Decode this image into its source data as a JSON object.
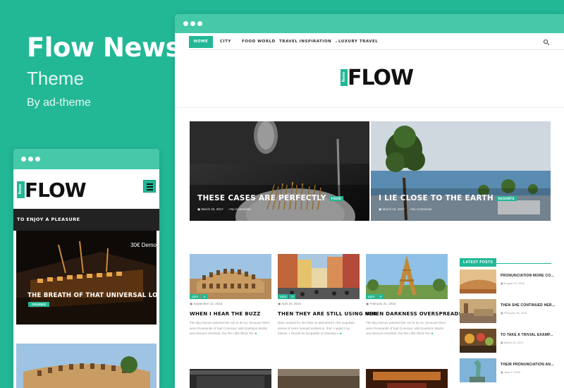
{
  "brand": {
    "title": "Flow News",
    "subtitle": "Theme",
    "author": "By ad-theme"
  },
  "colors": {
    "accent": "#22b896",
    "chrome": "#45c9a8",
    "dark_bar": "#222222"
  },
  "desktop": {
    "nav": [
      {
        "label": "HOME",
        "active": true
      },
      {
        "label": "CITY",
        "active": false
      },
      {
        "label": "FOOD WORLD",
        "active": false
      },
      {
        "label": "TRAVEL INSPIRATION",
        "active": false,
        "dropdown": true
      },
      {
        "label": "LUXURY TRAVEL",
        "active": false
      }
    ],
    "dropdown_caret": "⌄",
    "search_icon": "search-icon",
    "logo": {
      "badge": "News",
      "text": "FLOW"
    },
    "heroes": [
      {
        "title": "THESE CASES ARE PERFECTLY",
        "tag": "FOOD",
        "date": "March 23, 2017",
        "comments": "No Comments"
      },
      {
        "title": "I LIE CLOSE TO THE EARTH",
        "tag": "RESORTS",
        "date": "March 23, 2017",
        "comments": "No Comments"
      }
    ],
    "cards": [
      {
        "tags": [
          "CITY",
          "↗"
        ],
        "date": "September 13, 2016",
        "title": "WHEN I HEAR THE BUZZ",
        "excerpt": "The Big Oxmox advised her not to do so, because there were thousands of bad Commas, wild Question Marks and devious Semikoli, but the Little Blind Tex",
        "more": "►"
      },
      {
        "tags": [
          "CITY",
          "↗"
        ],
        "date": "April 26, 2016",
        "title": "THEN THEY ARE STILL USING HER",
        "excerpt": "Was created for the bliss so absorbed in the exquisite sense of mere tranquil existence, that I neglect my talents. I should be incapable of drawing a",
        "more": "►"
      },
      {
        "tags": [
          "CITY",
          "↗"
        ],
        "date": "February 21, 2016",
        "title": "WHEN DARKNESS OVERSPREADS",
        "excerpt": "The Big Oxmox advised her not to do so, because there were thousands of bad Commas, wild Question Marks and devious Semikoli, but the Little Blind Tex",
        "more": "►"
      }
    ],
    "latest_posts": {
      "heading": "LATEST POSTS",
      "items": [
        {
          "title": "PRONUNCIATION MORE CO...",
          "date": "August 19, 2016"
        },
        {
          "title": "THEN SHE CONTINUED HER...",
          "date": "February 16, 2016"
        },
        {
          "title": "TO TAKE A TRIVIAL EXAMP...",
          "date": "March 23, 2017"
        },
        {
          "title": "THEIR PRONUNCIATION AN...",
          "date": "June 2, 2016"
        }
      ]
    }
  },
  "mobile": {
    "logo": {
      "badge": "News",
      "text": "FLOW"
    },
    "menu_icon": "hamburger-icon",
    "bar_text": "TO ENJOY A PLEASURE",
    "featured": {
      "title": "THE BREATH OF THAT UNIVERSAL LOVE",
      "tag": "CRUISES",
      "overlay_text": "30€ Demo"
    }
  }
}
